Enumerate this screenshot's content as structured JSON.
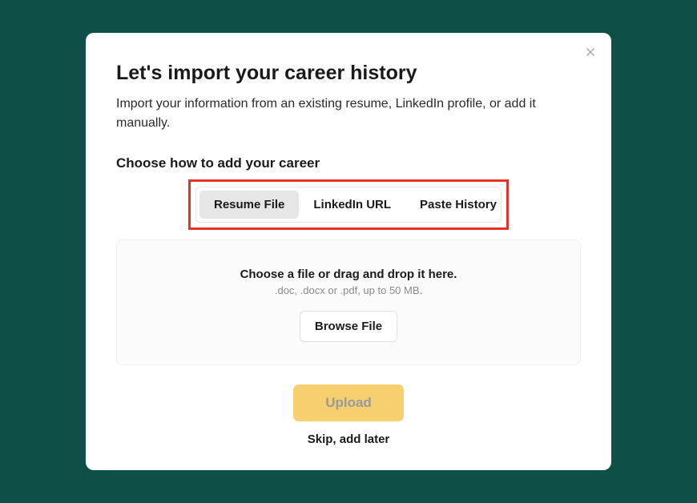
{
  "modal": {
    "title": "Let's import your career history",
    "subtitle": "Import your information from an existing resume, LinkedIn profile, or add it manually.",
    "section_label": "Choose how to add your career",
    "tabs": {
      "resume": "Resume File",
      "linkedin": "LinkedIn URL",
      "paste": "Paste History"
    },
    "dropzone": {
      "title": "Choose a file or drag and drop it here.",
      "hint": ".doc, .docx or .pdf, up to 50 MB.",
      "browse": "Browse File"
    },
    "actions": {
      "upload": "Upload",
      "skip": "Skip, add later"
    }
  }
}
